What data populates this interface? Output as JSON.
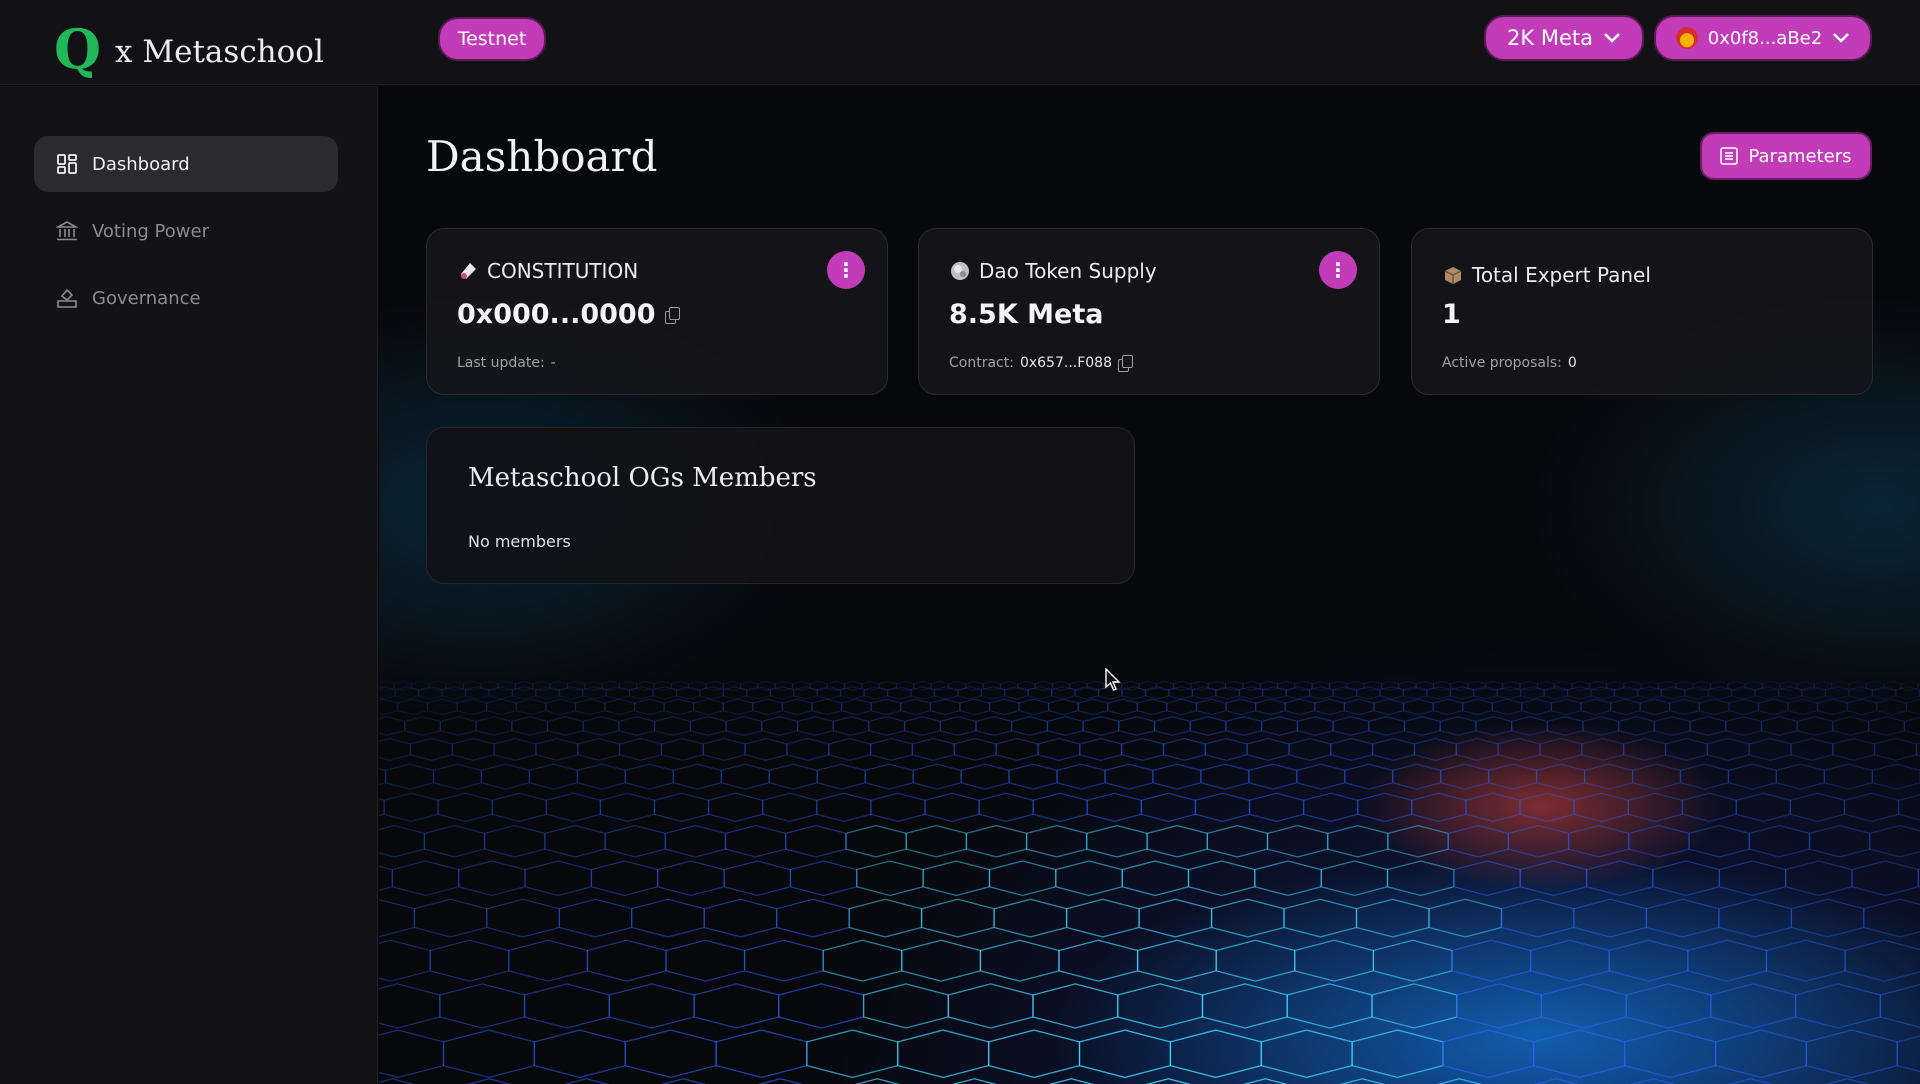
{
  "header": {
    "logo_mark": "Q",
    "logo_text": "x Metaschool",
    "network_label": "Testnet",
    "balance_label": "2K Meta",
    "wallet_label": "0x0f8...aBe2"
  },
  "sidebar": {
    "items": [
      {
        "label": "Dashboard",
        "icon": "grid-icon",
        "active": true
      },
      {
        "label": "Voting Power",
        "icon": "bank-icon",
        "active": false
      },
      {
        "label": "Governance",
        "icon": "vote-icon",
        "active": false
      }
    ]
  },
  "main": {
    "title": "Dashboard",
    "parameters_label": "Parameters",
    "cards": [
      {
        "label": "CONSTITUTION",
        "value": "0x000...0000",
        "foot_label": "Last update:",
        "foot_value": "-",
        "icon": "scroll-icon"
      },
      {
        "label": "Dao Token Supply",
        "value": "8.5K Meta",
        "foot_label": "Contract:",
        "foot_value": "0x657...F088",
        "icon": "coin-icon"
      },
      {
        "label": "Total Expert Panel",
        "value": "1",
        "foot_label": "Active proposals:",
        "foot_value": "0",
        "icon": "box-icon"
      }
    ],
    "members": {
      "title": "Metaschool OGs Members",
      "empty_text": "No members"
    }
  },
  "colors": {
    "accent": "#c23bb8",
    "logo_green": "#1fb85a",
    "background": "#0b0b0d",
    "panel": "#131315"
  }
}
